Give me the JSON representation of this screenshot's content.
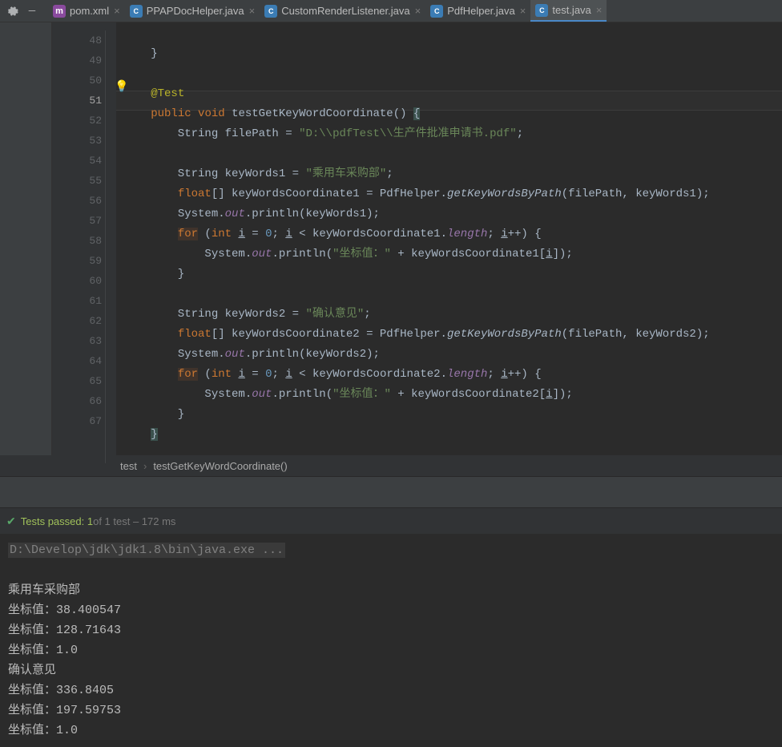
{
  "tabs": [
    {
      "label": "pom.xml",
      "iconType": "maven",
      "iconText": "m",
      "active": false
    },
    {
      "label": "PPAPDocHelper.java",
      "iconType": "java",
      "iconText": "C",
      "active": false
    },
    {
      "label": "CustomRenderListener.java",
      "iconType": "java",
      "iconText": "C",
      "active": false
    },
    {
      "label": "PdfHelper.java",
      "iconType": "java",
      "iconText": "C",
      "active": false
    },
    {
      "label": "test.java",
      "iconType": "java",
      "iconText": "C",
      "active": true
    }
  ],
  "lineNumbers": [
    "48",
    "49",
    "50",
    "51",
    "52",
    "53",
    "54",
    "55",
    "56",
    "57",
    "58",
    "59",
    "60",
    "61",
    "62",
    "63",
    "64",
    "65",
    "66",
    "67"
  ],
  "activeLine": "51",
  "code": {
    "annotation": "@Test",
    "keywords": {
      "public": "public",
      "void": "void",
      "float": "float",
      "for": "for",
      "int": "int"
    },
    "methodName": "testGetKeyWordCoordinate",
    "filePathVar": "filePath",
    "filePathStr": "\"D:\\\\pdfTest\\\\生产件批准申请书.pdf\"",
    "keyWords1Var": "keyWords1",
    "keyWords1Str": "\"乘用车采购部\"",
    "coord1Var": "keyWordsCoordinate1",
    "helper": "PdfHelper",
    "getMethod": "getKeyWordsByPath",
    "sys": "System",
    "out": "out",
    "println": "println",
    "loopVar": "i",
    "lengthProp": "length",
    "coordLabel": "\"坐标值：\"",
    "keyWords2Var": "keyWords2",
    "keyWords2Str": "\"确认意见\"",
    "coord2Var": "keyWordsCoordinate2",
    "zero": "0"
  },
  "breadcrumb": {
    "class": "test",
    "method": "testGetKeyWordCoordinate()"
  },
  "testBar": {
    "passedLabel": "Tests passed:",
    "passedCount": "1",
    "ofText": " of 1 test – 172 ms"
  },
  "console": {
    "exe": "D:\\Develop\\jdk\\jdk1.8\\bin\\java.exe ...",
    "lines": [
      "乘用车采购部",
      "坐标值：38.400547",
      "坐标值：128.71643",
      "坐标值：1.0",
      "确认意见",
      "坐标值：336.8405",
      "坐标值：197.59753",
      "坐标值：1.0"
    ]
  }
}
